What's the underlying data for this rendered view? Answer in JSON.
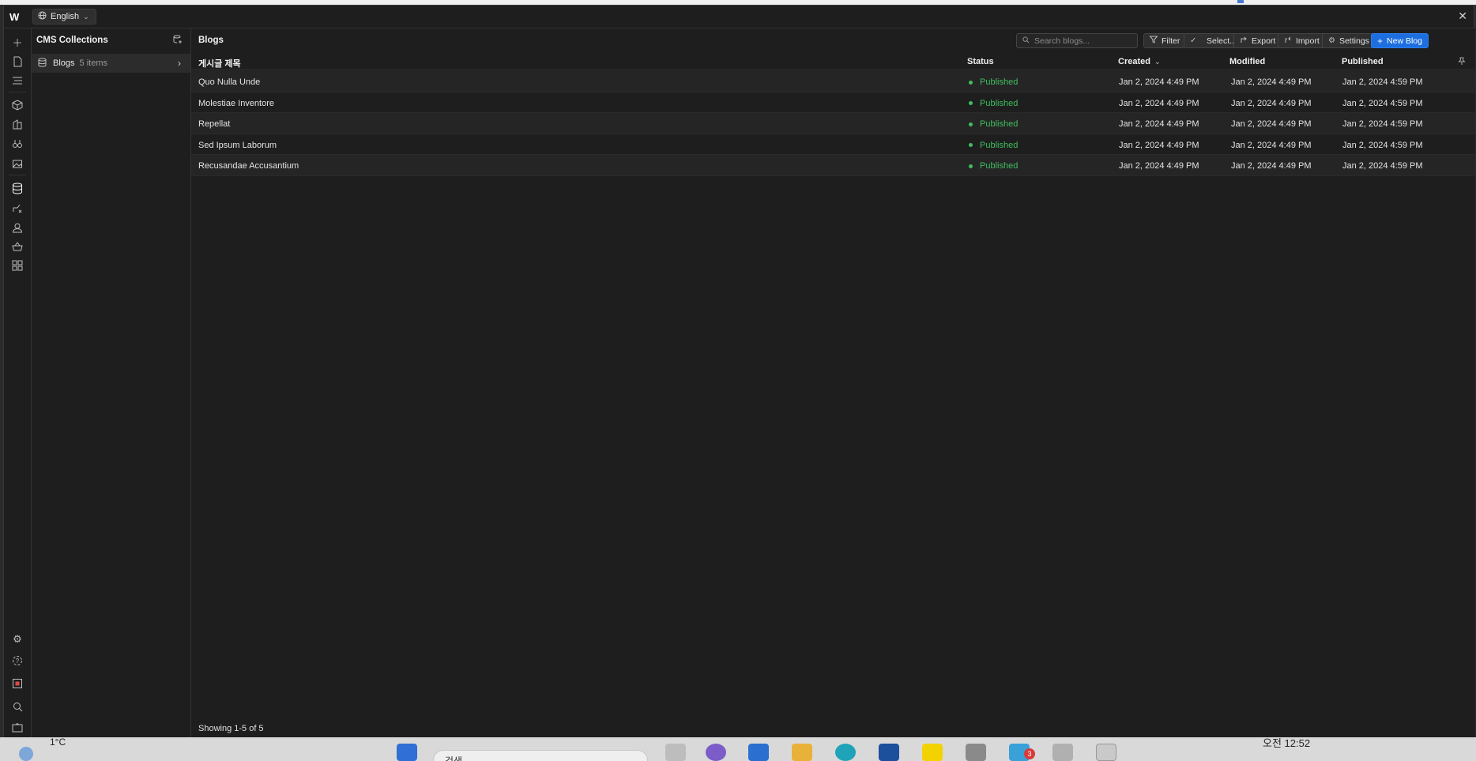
{
  "topbar": {
    "logo": "W",
    "language": "English"
  },
  "collections": {
    "title": "CMS Collections",
    "items": [
      {
        "label": "Blogs",
        "count": "5 items"
      }
    ]
  },
  "main": {
    "title": "Blogs",
    "search_placeholder": "Search blogs...",
    "toolbar": {
      "filter": "Filter",
      "select": "Select...",
      "export": "Export",
      "import": "Import",
      "settings": "Settings",
      "new": "New Blog"
    },
    "columns": {
      "title": "게시글 제목",
      "status": "Status",
      "created": "Created",
      "modified": "Modified",
      "published": "Published"
    },
    "rows": [
      {
        "title": "Quo Nulla Unde",
        "status": "Published",
        "created": "Jan 2, 2024 4:49 PM",
        "modified": "Jan 2, 2024 4:49 PM",
        "published": "Jan 2, 2024 4:59 PM"
      },
      {
        "title": "Molestiae Inventore",
        "status": "Published",
        "created": "Jan 2, 2024 4:49 PM",
        "modified": "Jan 2, 2024 4:49 PM",
        "published": "Jan 2, 2024 4:59 PM"
      },
      {
        "title": "Repellat",
        "status": "Published",
        "created": "Jan 2, 2024 4:49 PM",
        "modified": "Jan 2, 2024 4:49 PM",
        "published": "Jan 2, 2024 4:59 PM"
      },
      {
        "title": "Sed Ipsum Laborum",
        "status": "Published",
        "created": "Jan 2, 2024 4:49 PM",
        "modified": "Jan 2, 2024 4:49 PM",
        "published": "Jan 2, 2024 4:59 PM"
      },
      {
        "title": "Recusandae Accusantium",
        "status": "Published",
        "created": "Jan 2, 2024 4:49 PM",
        "modified": "Jan 2, 2024 4:49 PM",
        "published": "Jan 2, 2024 4:59 PM"
      }
    ],
    "footer": "Showing 1-5 of 5"
  },
  "taskbar": {
    "weather": "1°C",
    "search": "검색",
    "badge": "3",
    "clock": "오전 12:52"
  },
  "colors": {
    "accent": "#1d6fe0",
    "published": "#3fbf5f",
    "background": "#1e1e1e"
  }
}
